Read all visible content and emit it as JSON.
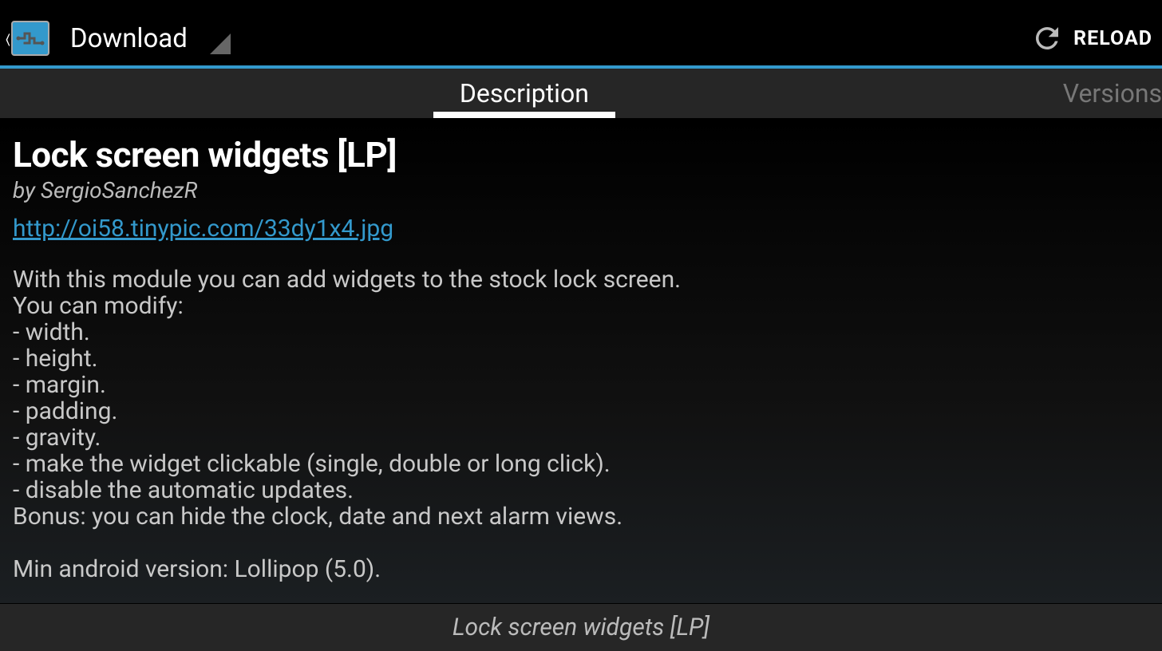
{
  "header": {
    "title": "Download",
    "reload_label": "RELOAD"
  },
  "tabs": {
    "description_label": "Description",
    "versions_label": "Versions"
  },
  "module": {
    "title": "Lock screen widgets [LP]",
    "author": "by SergioSanchezR",
    "link": "http://oi58.tinypic.com/33dy1x4.jpg",
    "description": "With this module you can add widgets to the stock lock screen.\nYou can modify:\n- width.\n- height.\n- margin.\n- padding.\n- gravity.\n- make the widget clickable (single, double or long click).\n- disable the automatic updates.\nBonus: you can hide the clock, date and next alarm views.\n\nMin android version: Lollipop (5.0)."
  },
  "footer": {
    "title": "Lock screen widgets [LP]"
  }
}
